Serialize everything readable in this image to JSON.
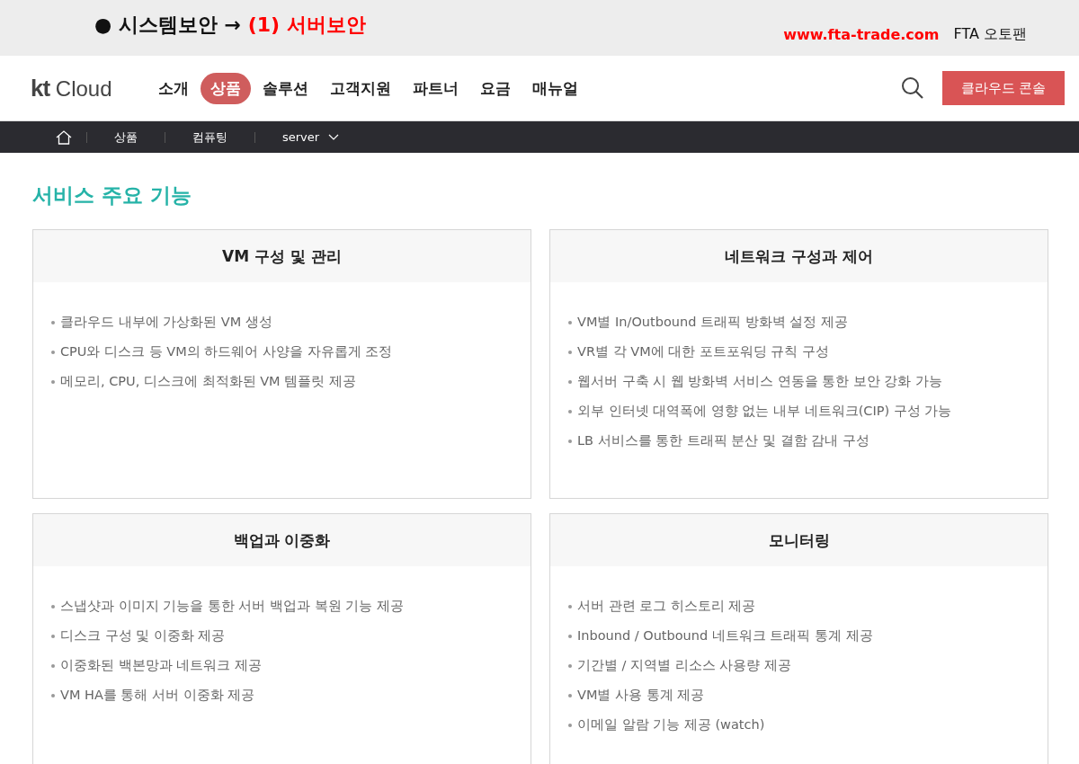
{
  "banner": {
    "lead": "● 시스템보안 →",
    "highlight": "(1) 서버보안",
    "site": "www.fta-trade.com",
    "brand": "FTA 오토팬"
  },
  "header": {
    "logo_mark": "kt",
    "logo_text": "Cloud",
    "nav": [
      {
        "label": "소개",
        "selected": false
      },
      {
        "label": "상품",
        "selected": true
      },
      {
        "label": "솔루션",
        "selected": false
      },
      {
        "label": "고객지원",
        "selected": false
      },
      {
        "label": "파트너",
        "selected": false
      },
      {
        "label": "요금",
        "selected": false
      },
      {
        "label": "매뉴얼",
        "selected": false
      }
    ],
    "console_button": "클라우드 콘솔"
  },
  "breadcrumb": [
    {
      "label": "상품"
    },
    {
      "label": "컴퓨팅"
    },
    {
      "label": "server",
      "dropdown": true
    }
  ],
  "section_title": "서비스 주요 기능",
  "cards": [
    {
      "title": "VM 구성 및 관리",
      "items": [
        "클라우드 내부에 가상화된 VM 생성",
        "CPU와 디스크 등 VM의 하드웨어 사양을 자유롭게 조정",
        "메모리, CPU, 디스크에 최적화된 VM 템플릿 제공"
      ]
    },
    {
      "title": "네트워크 구성과 제어",
      "items": [
        "VM별 In/Outbound 트래픽 방화벽 설정 제공",
        "VR별 각 VM에 대한 포트포워딩 규칙 구성",
        "웹서버 구축 시 웹 방화벽 서비스 연동을 통한 보안 강화 가능",
        "외부 인터넷 대역폭에 영향 없는 내부 네트워크(CIP) 구성 가능",
        "LB 서비스를 통한 트래픽 분산 및 결함 감내 구성"
      ]
    },
    {
      "title": "백업과 이중화",
      "items": [
        "스냅샷과 이미지 기능을 통한 서버 백업과 복원 기능 제공",
        "디스크 구성 및 이중화 제공",
        "이중화된 백본망과 네트워크 제공",
        "VM HA를 통해 서버 이중화 제공"
      ]
    },
    {
      "title": "모니터링",
      "items": [
        "서버 관련 로그 히스토리 제공",
        "Inbound / Outbound 네트워크 트래픽 통계 제공",
        "기간별 / 지역별 리소스 사용량 제공",
        "VM별 사용 통계 제공",
        "이메일 알람 기능 제공 (watch)"
      ]
    }
  ]
}
